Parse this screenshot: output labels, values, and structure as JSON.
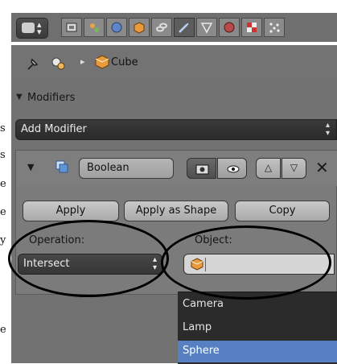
{
  "page_edge": {
    "fragments": [
      "s",
      "s",
      "e",
      "e",
      "y",
      "e"
    ]
  },
  "header": {
    "context_tabs": [
      "render-layers-icon",
      "scene-icon",
      "world-icon",
      "object-icon",
      "constraints-icon",
      "modifiers-icon",
      "data-icon",
      "material-icon",
      "texture-icon",
      "particles-icon"
    ],
    "active_tab": "modifiers-icon"
  },
  "breadcrumb": {
    "object": "Cube"
  },
  "modifiers_panel": {
    "title": "Modifiers",
    "add_modifier": "Add Modifier",
    "modifier": {
      "name": "Boolean",
      "buttons": {
        "apply": "Apply",
        "apply_as_shape": "Apply as Shape",
        "copy": "Copy"
      },
      "operation_label": "Operation:",
      "operation_value": "Intersect",
      "object_label": "Object:",
      "object_value": ""
    }
  },
  "object_dropdown": {
    "options": [
      "Camera",
      "Lamp",
      "Sphere"
    ],
    "selected": "Sphere"
  },
  "colors": {
    "highlight": "#5680c2",
    "panel_bg": "#727272",
    "cube_orange": "#e89a3c"
  }
}
